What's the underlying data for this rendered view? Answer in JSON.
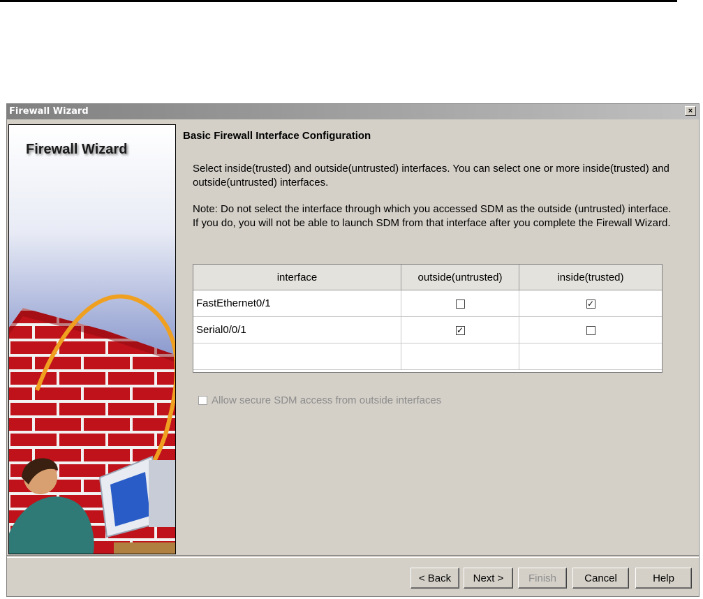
{
  "window": {
    "title": "Firewall Wizard",
    "close_label": "×"
  },
  "banner": {
    "title": "Firewall Wizard"
  },
  "content": {
    "heading": "Basic Firewall Interface Configuration",
    "intro": "Select inside(trusted) and outside(untrusted) interfaces. You can select one or more inside(trusted) and outside(untrusted) interfaces.",
    "note": "Note: Do not select the interface through which you accessed SDM as the outside (untrusted) interface. If you do, you will not be able to launch SDM from that interface after you complete the Firewall Wizard."
  },
  "table": {
    "headers": [
      "interface",
      "outside(untrusted)",
      "inside(trusted)"
    ],
    "rows": [
      {
        "interface": "FastEthernet0/1",
        "outside_checked": false,
        "inside_checked": true
      },
      {
        "interface": "Serial0/0/1",
        "outside_checked": true,
        "inside_checked": false
      }
    ]
  },
  "allow_secure": {
    "label": "Allow secure SDM access from outside interfaces",
    "checked": false,
    "enabled": false
  },
  "buttons": {
    "back": "< Back",
    "next": "Next >",
    "finish": "Finish",
    "cancel": "Cancel",
    "help": "Help"
  },
  "colors": {
    "sky_top": "#ffffff",
    "sky_bottom": "#5a6fb4",
    "brick": "#c0121a",
    "mortar": "#f2f2f2",
    "cable": "#f0a020"
  }
}
